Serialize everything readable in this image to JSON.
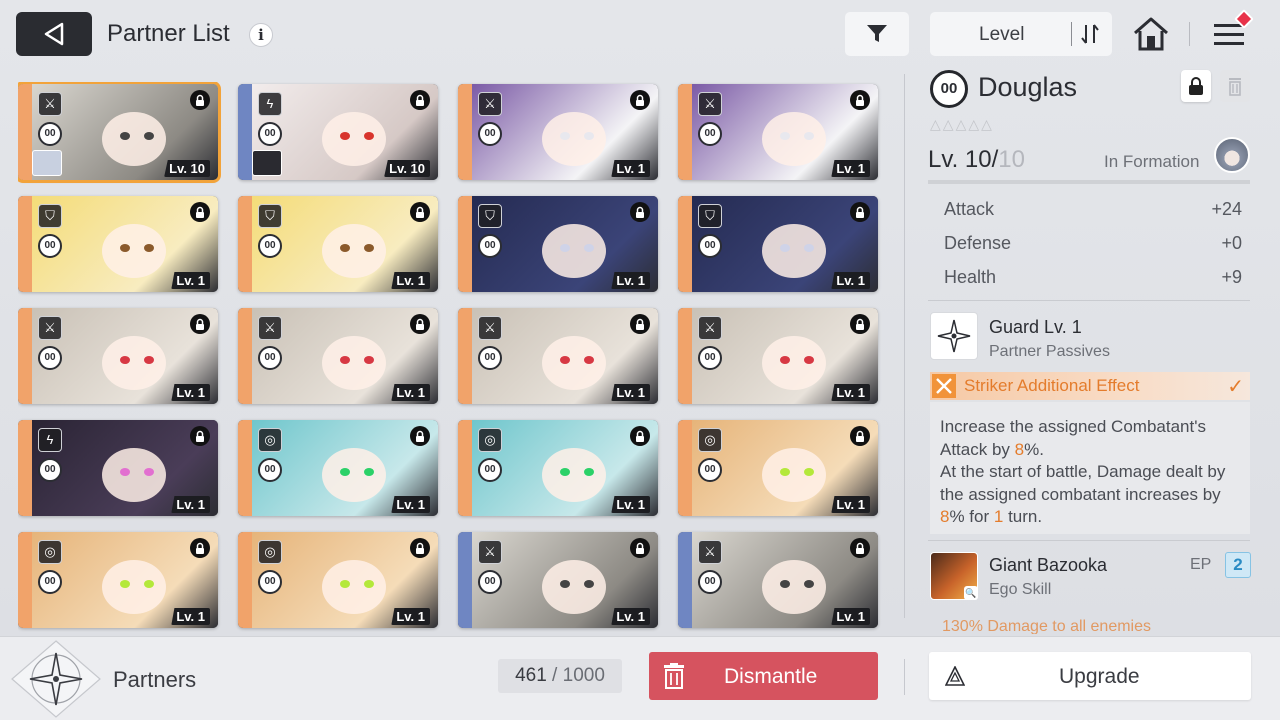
{
  "header": {
    "title": "Partner List",
    "info_glyph": "i",
    "sort_label": "Level"
  },
  "cards": [
    {
      "level": "Lv. 10",
      "role": "striker",
      "strip_color": "#f1a36a",
      "palette": [
        "#d9d6cf",
        "#8d8a84"
      ],
      "accent": "#444",
      "mini": "light",
      "selected": true
    },
    {
      "level": "Lv. 10",
      "role": "lightning",
      "strip_color": "#6f86c2",
      "palette": [
        "#f2ecec",
        "#d6c9c6"
      ],
      "accent": "#d8342c",
      "mini": "dark",
      "selected": false
    },
    {
      "level": "Lv. 1",
      "role": "striker",
      "strip_color": "#f1a36a",
      "palette": [
        "#7b5aa6",
        "#f4f4f6"
      ],
      "accent": "#e8e8ee",
      "mini": "none",
      "selected": false
    },
    {
      "level": "Lv. 1",
      "role": "striker",
      "strip_color": "#f1a36a",
      "palette": [
        "#7b5aa6",
        "#f4f4f6"
      ],
      "accent": "#e8e8ee",
      "mini": "none",
      "selected": false
    },
    {
      "level": "Lv. 1",
      "role": "shield",
      "strip_color": "#f1a36a",
      "palette": [
        "#f4dc78",
        "#f8ecc0"
      ],
      "accent": "#8b5a2b",
      "mini": "none",
      "selected": false
    },
    {
      "level": "Lv. 1",
      "role": "shield",
      "strip_color": "#f1a36a",
      "palette": [
        "#f4dc78",
        "#f8ecc0"
      ],
      "accent": "#8b5a2b",
      "mini": "none",
      "selected": false
    },
    {
      "level": "Lv. 1",
      "role": "shield",
      "strip_color": "#f1a36a",
      "palette": [
        "#252b52",
        "#3b4478"
      ],
      "accent": "#cfd3e8",
      "mini": "none",
      "selected": false
    },
    {
      "level": "Lv. 1",
      "role": "shield",
      "strip_color": "#f1a36a",
      "palette": [
        "#252b52",
        "#3b4478"
      ],
      "accent": "#cfd3e8",
      "mini": "none",
      "selected": false
    },
    {
      "level": "Lv. 1",
      "role": "striker",
      "strip_color": "#f1a36a",
      "palette": [
        "#c9c1b6",
        "#e8e2da"
      ],
      "accent": "#d73843",
      "mini": "none",
      "selected": false
    },
    {
      "level": "Lv. 1",
      "role": "striker",
      "strip_color": "#f1a36a",
      "palette": [
        "#c9c1b6",
        "#e8e2da"
      ],
      "accent": "#d73843",
      "mini": "none",
      "selected": false
    },
    {
      "level": "Lv. 1",
      "role": "striker",
      "strip_color": "#f1a36a",
      "palette": [
        "#c9c1b6",
        "#e8e2da"
      ],
      "accent": "#d73843",
      "mini": "none",
      "selected": false
    },
    {
      "level": "Lv. 1",
      "role": "striker",
      "strip_color": "#f1a36a",
      "palette": [
        "#c9c1b6",
        "#e8e2da"
      ],
      "accent": "#d73843",
      "mini": "none",
      "selected": false
    },
    {
      "level": "Lv. 1",
      "role": "lightning",
      "strip_color": "#f1a36a",
      "palette": [
        "#2a2434",
        "#4a3d58"
      ],
      "accent": "#e26fd0",
      "mini": "none",
      "selected": false
    },
    {
      "level": "Lv. 1",
      "role": "target",
      "strip_color": "#f1a36a",
      "palette": [
        "#6fc6cc",
        "#c7e8ea"
      ],
      "accent": "#2bd168",
      "mini": "none",
      "selected": false
    },
    {
      "level": "Lv. 1",
      "role": "target",
      "strip_color": "#f1a36a",
      "palette": [
        "#6fc6cc",
        "#c7e8ea"
      ],
      "accent": "#2bd168",
      "mini": "none",
      "selected": false
    },
    {
      "level": "Lv. 1",
      "role": "target",
      "strip_color": "#f1a36a",
      "palette": [
        "#e6b47a",
        "#f5dcb8"
      ],
      "accent": "#b4e83a",
      "mini": "none",
      "selected": false
    },
    {
      "level": "Lv. 1",
      "role": "target",
      "strip_color": "#f1a36a",
      "palette": [
        "#e6b47a",
        "#f5dcb8"
      ],
      "accent": "#b4e83a",
      "mini": "none",
      "selected": false
    },
    {
      "level": "Lv. 1",
      "role": "target",
      "strip_color": "#f1a36a",
      "palette": [
        "#e6b47a",
        "#f5dcb8"
      ],
      "accent": "#b4e83a",
      "mini": "none",
      "selected": false
    },
    {
      "level": "Lv. 1",
      "role": "striker",
      "strip_color": "#6f86c2",
      "palette": [
        "#d9d6cf",
        "#8d8a84"
      ],
      "accent": "#444",
      "mini": "none",
      "selected": false
    },
    {
      "level": "Lv. 1",
      "role": "striker",
      "strip_color": "#6f86c2",
      "palette": [
        "#d9d6cf",
        "#8d8a84"
      ],
      "accent": "#444",
      "mini": "none",
      "selected": false
    }
  ],
  "card_rank_text": "00",
  "role_glyphs": {
    "striker": "⚔",
    "lightning": "ϟ",
    "shield": "⛉",
    "target": "◎"
  },
  "detail": {
    "rank_text": "00",
    "name": "Douglas",
    "stars": [
      "△",
      "△",
      "△",
      "△",
      "△"
    ],
    "level_current": "Lv. 10/",
    "level_max": "10",
    "formation": "In Formation",
    "stats": [
      {
        "label": "Attack",
        "value": "+24"
      },
      {
        "label": "Defense",
        "value": "+0"
      },
      {
        "label": "Health",
        "value": "+9"
      }
    ],
    "passive_name": "Guard Lv. 1",
    "passive_type": "Partner Passives",
    "striker_label": "Striker Additional Effect",
    "striker_check": "✓",
    "desc": {
      "p1": "Increase the assigned Combatant's Attack by ",
      "v1": "8",
      "p2": "%.",
      "p3": "At the start of battle, Damage dealt by the assigned combatant increases by ",
      "v2": "8",
      "p4": "% for ",
      "v3": "1",
      "p5": " turn."
    },
    "ego_name": "Giant Bazooka",
    "ego_type": "Ego Skill",
    "ep_label": "EP",
    "ep_value": "2",
    "ego_zoom_glyph": "🔍",
    "cut_text": "130% Damage to all enemies"
  },
  "bottom": {
    "partners_label": "Partners",
    "count_current": "461",
    "count_sep": " / ",
    "count_max": "1000",
    "dismantle_label": "Dismantle",
    "upgrade_label": "Upgrade"
  },
  "colors": {
    "accent_orange": "#e47c2c",
    "dismantle_red": "#d6535f",
    "selected_outline": "#f2a33a",
    "ep_blue": "#2a8bc4"
  }
}
